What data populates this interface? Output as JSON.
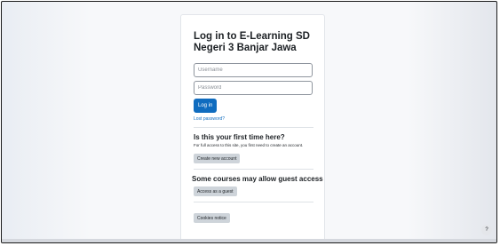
{
  "login": {
    "title": "Log in to E-Learning SD Negeri 3 Banjar Jawa",
    "username_placeholder": "Username",
    "password_placeholder": "Password",
    "login_button": "Log in",
    "lost_password": "Lost password?"
  },
  "first_time": {
    "heading": "Is this your first time here?",
    "text": "For full access to this site, you first need to create an account.",
    "create_button": "Create new account"
  },
  "guest": {
    "heading": "Some courses may allow guest access",
    "button": "Access as a guest"
  },
  "footer": {
    "cookies_button": "Cookies notice",
    "help_label": "?"
  },
  "colors": {
    "primary": "#0f6cbf",
    "secondary_button": "#ced4da",
    "page_background": "#f7f8fa"
  }
}
